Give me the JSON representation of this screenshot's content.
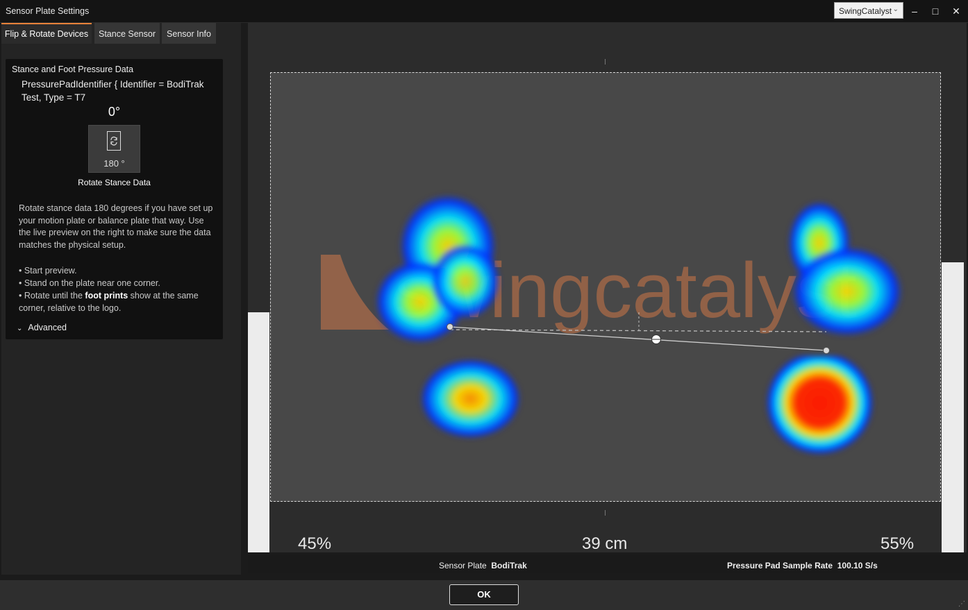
{
  "window": {
    "title": "Sensor Plate Settings",
    "account_selector": "SwingCatalyst",
    "minimize": "–",
    "maximize": "□",
    "close": "✕"
  },
  "tabs": [
    {
      "label": "Flip & Rotate Devices",
      "active": true
    },
    {
      "label": "Stance Sensor",
      "active": false
    },
    {
      "label": "Sensor Info",
      "active": false
    }
  ],
  "stance_card": {
    "title": "Stance and Foot Pressure Data",
    "identifier": "PressurePadIdentifier { Identifier = BodiTrak Test, Type = T7",
    "angle": "0°",
    "rotate_button_label": "180 °",
    "rotate_label": "Rotate Stance Data",
    "description": "Rotate stance data 180 degrees if you have set up your motion plate or balance plate that way. Use the live preview on the right to make sure the data matches the physical setup.",
    "steps": {
      "s1": "• Start preview.",
      "s2": "• Stand on the plate near one corner.",
      "s3_pre": "• Rotate until the ",
      "s3_bold": "foot prints",
      "s3_post": " show at the same corner, relative to the logo."
    },
    "advanced": "Advanced"
  },
  "preview": {
    "logo_text": "swingcatalyst",
    "left_percent": "45%",
    "distance": "39 cm",
    "right_percent": "55%"
  },
  "info_bar": {
    "sensor_plate_label": "Sensor Plate",
    "sensor_plate_value": "BodiTrak",
    "sample_rate_label": "Pressure Pad Sample Rate",
    "sample_rate_value": "100.10 S/s"
  },
  "footer": {
    "ok": "OK"
  },
  "colors": {
    "accent": "#e8823a",
    "logo": "#a0674a"
  }
}
